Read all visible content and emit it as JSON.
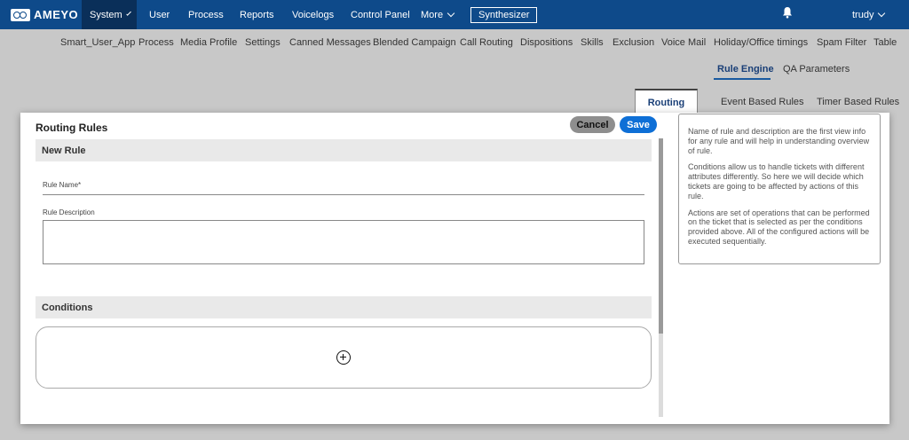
{
  "brand": {
    "name": "AMEYO"
  },
  "topnav": {
    "items": [
      "System",
      "User",
      "Process",
      "Reports",
      "Voicelogs",
      "Control Panel",
      "More"
    ],
    "synthesizer": "Synthesizer",
    "user": "trudy"
  },
  "submenu": {
    "items": [
      "Smart_User_App",
      "Process",
      "Media Profile",
      "Settings",
      "Canned Messages",
      "Blended Campaign",
      "Call Routing",
      "Dispositions",
      "Skills",
      "Exclusion",
      "Voice Mail",
      "Holiday/Office timings",
      "Spam Filter",
      "Table"
    ],
    "row2": [
      "Rule Engine",
      "QA Parameters"
    ]
  },
  "tabs": [
    "Routing",
    "Event Based Rules",
    "Timer Based Rules"
  ],
  "form": {
    "title": "Routing Rules",
    "cancel": "Cancel",
    "save": "Save",
    "new_rule_header": "New Rule",
    "rule_name_label": "Rule Name*",
    "rule_desc_label": "Rule Description",
    "conditions_header": "Conditions"
  },
  "info": {
    "p1": "Name of rule and description are the first view info for any rule and will help in understanding overview of rule.",
    "p2": "Conditions allow us to handle tickets with different attributes differently. So here we will decide which tickets are going to be affected by actions of this rule.",
    "p3": "Actions are set of operations that can be performed on the ticket that is selected as per the conditions provided above. All of the configured actions will be executed sequentially."
  },
  "colors": {
    "nav_bg": "#0e4a8a",
    "nav_active": "#0a2f59",
    "save_btn": "#0e6fd6",
    "cancel_btn": "#8e8e8e"
  }
}
